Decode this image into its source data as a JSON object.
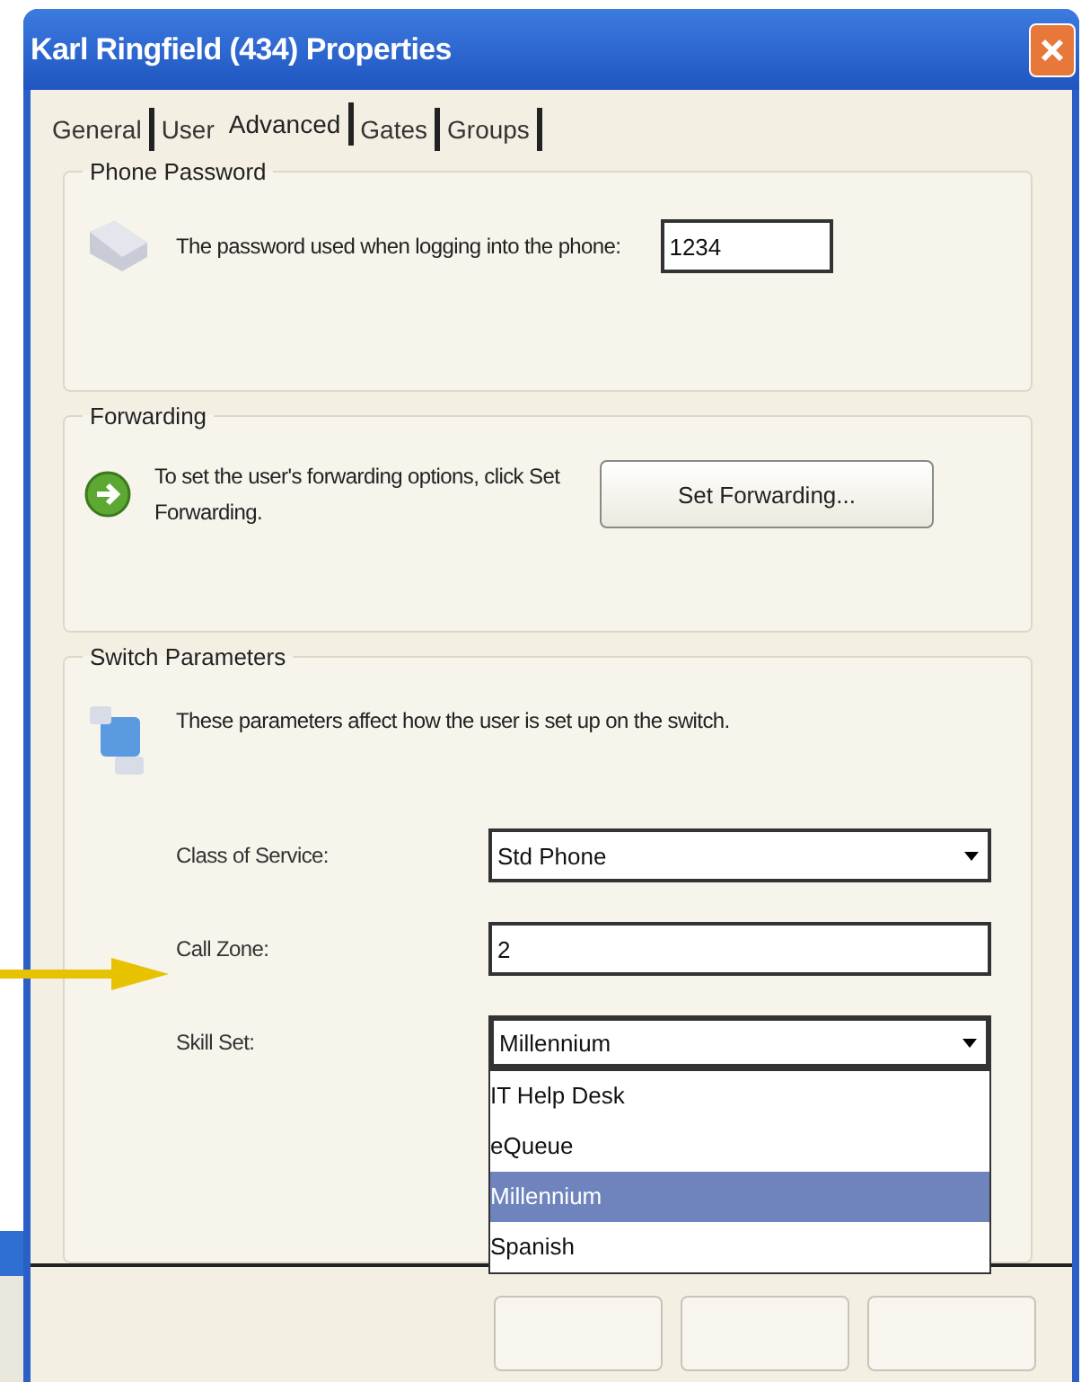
{
  "window": {
    "title": "Karl Ringfield (434) Properties"
  },
  "tabs": [
    {
      "label": "General",
      "selected": false
    },
    {
      "label": "User",
      "selected": false
    },
    {
      "label": "Advanced",
      "selected": true
    },
    {
      "label": "Gates",
      "selected": false
    },
    {
      "label": "Groups",
      "selected": false
    }
  ],
  "groups": [
    {
      "kind": "password",
      "title": "Phone Password",
      "text": "The password used when logging into the phone:",
      "value": "1234"
    },
    {
      "kind": "forwarding",
      "title": "Forwarding",
      "text": "To set the user's forwarding options, click Set Forwarding.",
      "button": "Set Forwarding..."
    },
    {
      "kind": "switch",
      "title": "Switch Parameters",
      "text": "These parameters affect how the user is set up on the switch.",
      "fields": [
        {
          "label": "Class of Service:",
          "kind": "dropdown",
          "value": "Std Phone",
          "expanded": false
        },
        {
          "label": "Call Zone:",
          "kind": "text",
          "value": "2"
        },
        {
          "label": "Skill Set:",
          "kind": "dropdown",
          "value": "Millennium",
          "expanded": true,
          "options": [
            {
              "label": "IT Help Desk",
              "selected": false
            },
            {
              "label": "eQueue",
              "selected": false
            },
            {
              "label": "Millennium",
              "selected": true
            },
            {
              "label": "Spanish",
              "selected": false
            }
          ]
        }
      ]
    }
  ]
}
